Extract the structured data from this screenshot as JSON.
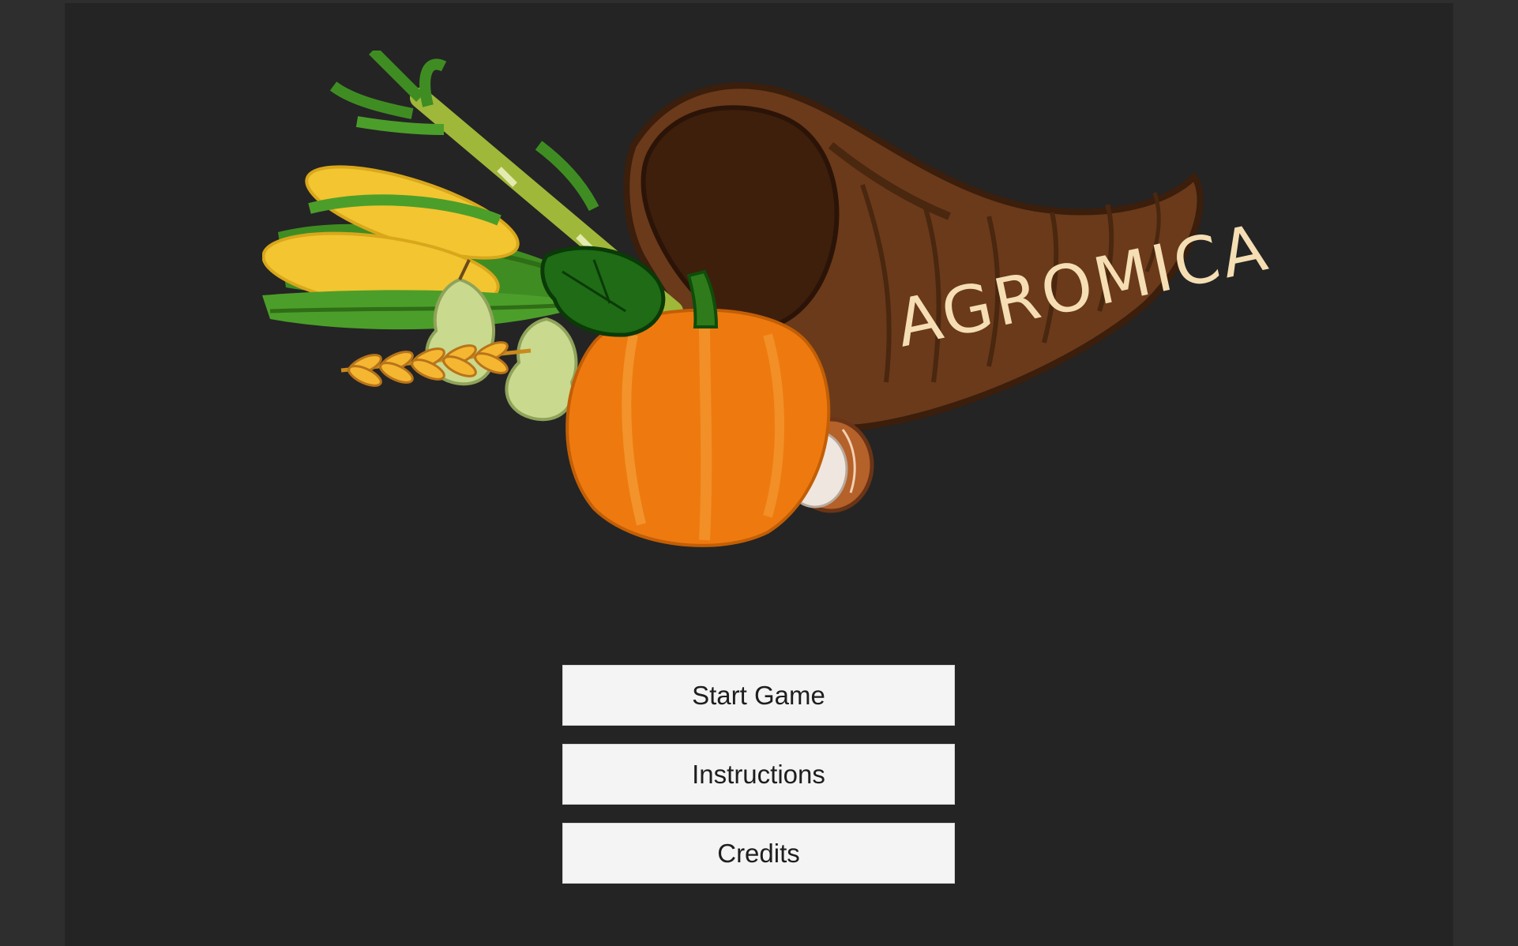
{
  "game": {
    "logo_text": "AGROMICA"
  },
  "menu": {
    "buttons": [
      {
        "id": "start",
        "label": "Start Game"
      },
      {
        "id": "instructions",
        "label": "Instructions"
      },
      {
        "id": "credits",
        "label": "Credits"
      }
    ]
  },
  "icons": {
    "logo": "cornucopia-harvest-logo"
  },
  "colors": {
    "background": "#242424",
    "side_bars": "#2e2e2e",
    "button_bg": "#f4f4f4",
    "button_text": "#1e1e1e",
    "horn": "#6b3a1a",
    "pumpkin": "#ee7a0f",
    "corn": "#f2c531",
    "leaf": "#3c8f1e",
    "logo_text": "#f5deb3"
  }
}
